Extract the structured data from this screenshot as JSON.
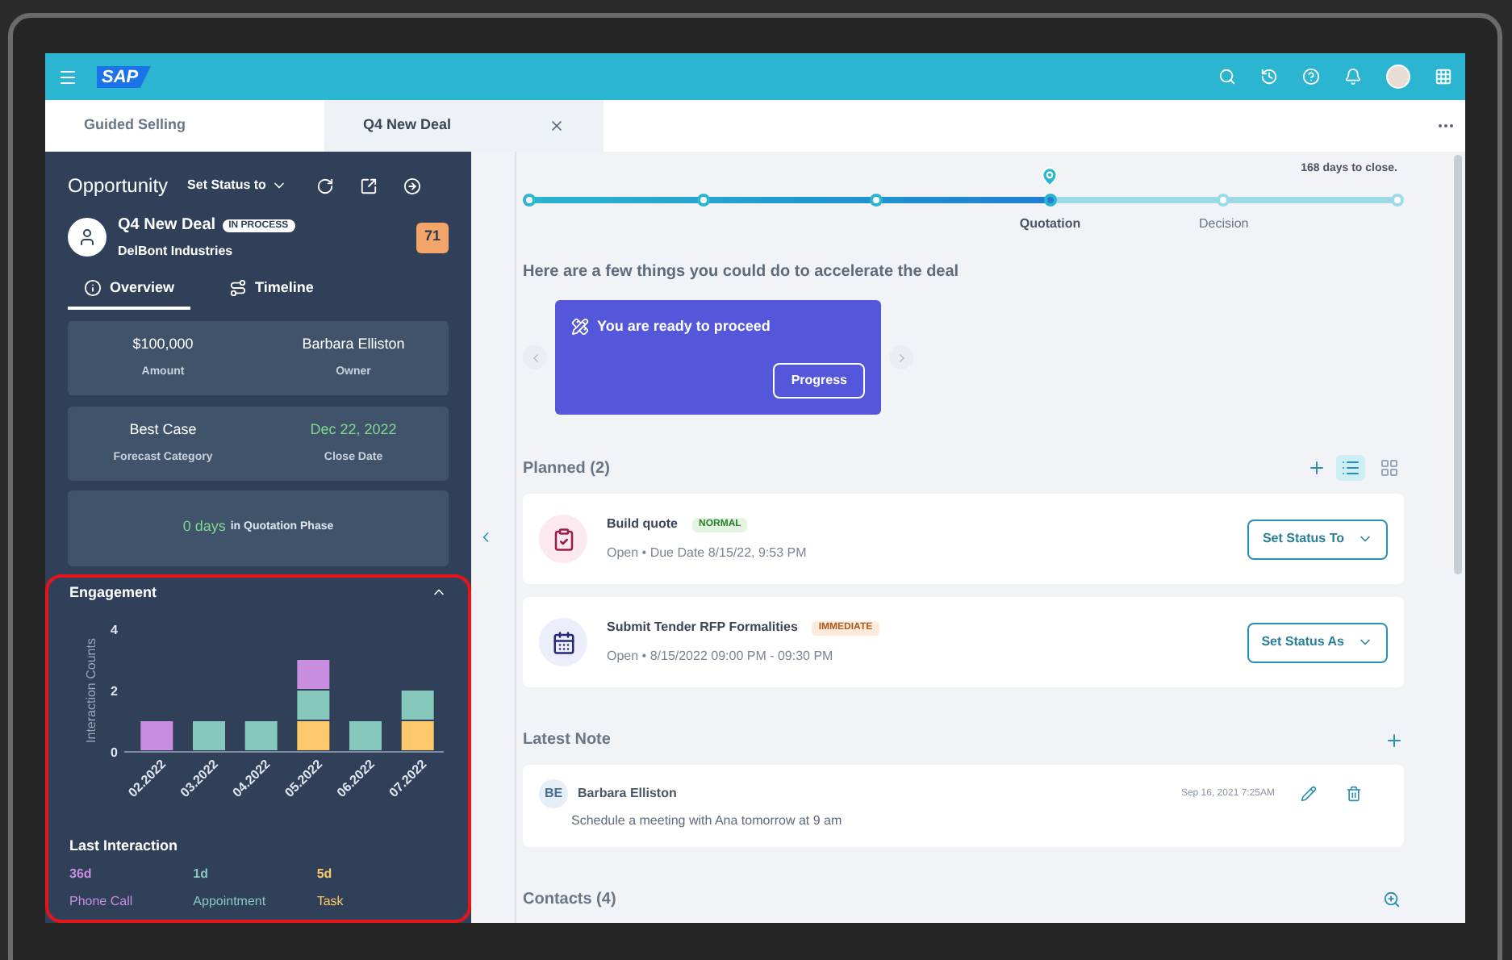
{
  "app_bar": {
    "logo": "SAP"
  },
  "tabs": [
    {
      "label": "Guided Selling",
      "selected": false,
      "closable": false
    },
    {
      "label": "Q4 New Deal",
      "selected": true,
      "closable": true
    }
  ],
  "opportunity": {
    "title": "Opportunity",
    "status_menu": "Set Status to",
    "deal_name": "Q4 New Deal",
    "status_badge": "IN PROCESS",
    "company": "DelBont Industries",
    "score": "71",
    "tabs": [
      {
        "label": "Overview",
        "selected": true
      },
      {
        "label": "Timeline",
        "selected": false
      }
    ],
    "cards": [
      [
        {
          "value": "$100,000",
          "label": "Amount",
          "highlight": false
        },
        {
          "value": "Barbara Elliston",
          "label": "Owner",
          "highlight": false
        }
      ],
      [
        {
          "value": "Best Case",
          "label": "Forecast Category",
          "highlight": false
        },
        {
          "value": "Dec 22, 2022",
          "label": "Close Date",
          "highlight": true
        }
      ]
    ],
    "phase": {
      "days": "0 days",
      "text": "in Quotation Phase"
    }
  },
  "engagement": {
    "title": "Engagement",
    "expanded": true,
    "highlighted": true,
    "chart_data": {
      "type": "bar",
      "ylabel": "Interaction Counts",
      "categories": [
        "02.2022",
        "03.2022",
        "04.2022",
        "05.2022",
        "06.2022",
        "07.2022"
      ],
      "stacked": true,
      "ylim": [
        0,
        4
      ],
      "yticks": [
        0,
        2,
        4
      ],
      "series": [
        {
          "color": "#fbc96b",
          "values": [
            0,
            0,
            0,
            1,
            0,
            1
          ]
        },
        {
          "color": "#86c8bc",
          "values": [
            0,
            1,
            1,
            1,
            1,
            1
          ]
        },
        {
          "color": "#c98de0",
          "values": [
            1,
            0,
            0,
            1,
            0,
            0
          ]
        }
      ]
    },
    "last_interaction": {
      "title": "Last Interaction",
      "items": [
        {
          "value": "36d",
          "label": "Phone Call",
          "color": "#c98de0"
        },
        {
          "value": "1d",
          "label": "Appointment",
          "color": "#86c8bc"
        },
        {
          "value": "5d",
          "label": "Task",
          "color": "#fbc96b"
        }
      ]
    }
  },
  "deal_progress": {
    "days_to_close": "168 days to close.",
    "stages": [
      {
        "selected": false
      },
      {
        "selected": false
      },
      {
        "selected": false
      },
      {
        "label": "Quotation",
        "selected": true
      },
      {
        "label": "Decision",
        "selected": false
      },
      {
        "selected": false
      }
    ]
  },
  "suggestions": {
    "heading": "Here are a few things you could do to accelerate the deal",
    "cards": [
      {
        "title": "You are ready to proceed",
        "button": "Progress"
      }
    ]
  },
  "planned": {
    "title": "Planned (2)",
    "views": [
      {
        "kind": "list",
        "selected": true
      },
      {
        "kind": "grid",
        "selected": false
      }
    ],
    "items": [
      {
        "kind": "task",
        "title": "Build quote",
        "priority": {
          "text": "NORMAL",
          "kind": "normal"
        },
        "meta": "Open • Due Date 8/15/22, 9:53 PM",
        "button": "Set Status To"
      },
      {
        "kind": "appointment",
        "title": "Submit Tender RFP Formalities",
        "priority": {
          "text": "IMMEDIATE",
          "kind": "immediate"
        },
        "meta": "Open • 8/15/2022 09:00 PM - 09:30 PM",
        "button": "Set Status As"
      }
    ]
  },
  "latest_note": {
    "title": "Latest Note",
    "initials": "BE",
    "author": "Barbara Elliston",
    "date": "Sep 16, 2021 7:25AM",
    "text": "Schedule a meeting with Ana tomorrow at 9 am"
  },
  "contacts": {
    "title": "Contacts (4)"
  }
}
